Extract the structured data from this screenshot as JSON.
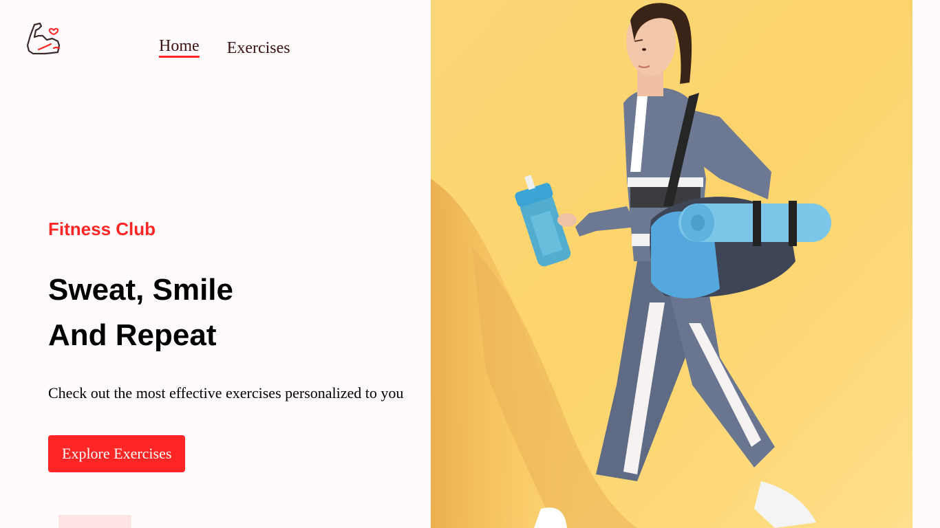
{
  "nav": {
    "home_label": "Home",
    "exercises_label": "Exercises"
  },
  "hero": {
    "brand": "Fitness Club",
    "headline_line1": "Sweat, Smile",
    "headline_line2": "And Repeat",
    "tagline": "Check out the most effective exercises personalized to you",
    "cta_label": "Explore Exercises"
  },
  "colors": {
    "accent": "#ff2625",
    "background": "#fffafb",
    "banner_bg": "#fdd46c"
  },
  "icons": {
    "logo": "flexed-arm-heart-icon"
  }
}
